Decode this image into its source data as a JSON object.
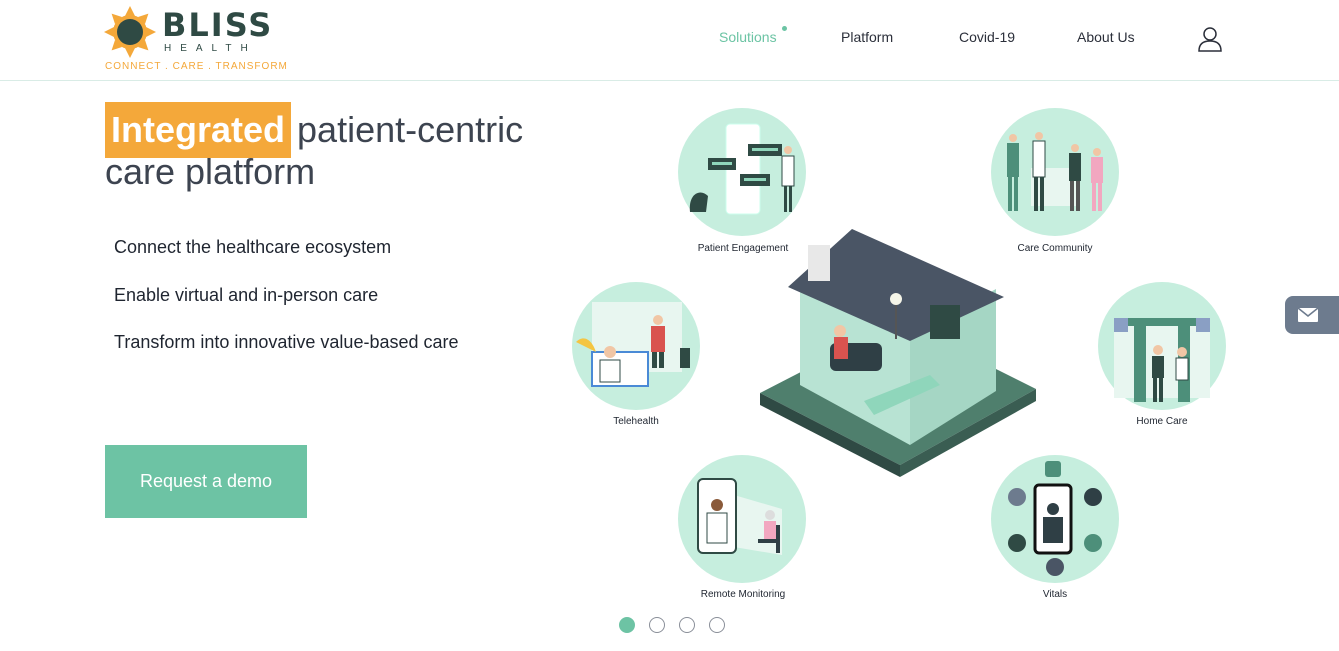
{
  "brand": {
    "name": "BLISS",
    "sub": "HEALTH",
    "tagline": "CONNECT . CARE . TRANSFORM",
    "colors": {
      "primary": "#6dc3a4",
      "accent": "#f4a83a",
      "dark": "#2f4a44"
    }
  },
  "nav": {
    "items": [
      {
        "label": "Solutions",
        "active": true
      },
      {
        "label": "Platform",
        "active": false
      },
      {
        "label": "Covid-19",
        "active": false
      },
      {
        "label": "About Us",
        "active": false
      }
    ],
    "user_icon": "user-icon"
  },
  "hero": {
    "highlight": "Integrated",
    "title_rest": "patient-centric",
    "title_line2": "care platform",
    "bullets": [
      "Connect the healthcare ecosystem",
      "Enable virtual and in-person care",
      "Transform into innovative value-based care"
    ],
    "cta": "Request a demo"
  },
  "illustration": {
    "labels": {
      "patient_engagement": "Patient Engagement",
      "care_community": "Care Community",
      "telehealth": "Telehealth",
      "home_care": "Home Care",
      "remote_monitoring": "Remote Monitoring",
      "vitals": "Vitals"
    }
  },
  "carousel": {
    "slides": 4,
    "active": 1
  },
  "side_tab": {
    "icon": "mail-icon"
  }
}
